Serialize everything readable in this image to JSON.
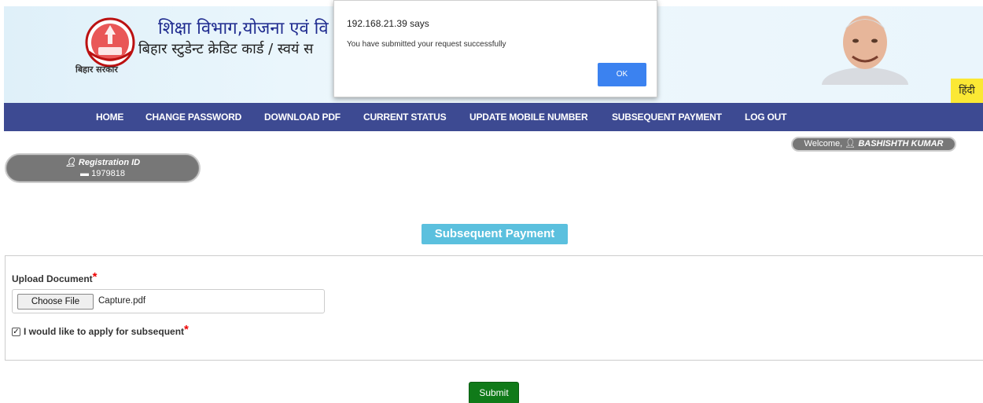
{
  "header": {
    "emblem_caption": "बिहार सरकार",
    "title_line1": "शिक्षा विभाग,योजना एवं वि",
    "title_line2": "बिहार स्टुडेन्ट क्रेडिट कार्ड / स्वयं स",
    "language_toggle": "हिंदी",
    "colors": {
      "nav_bg": "#3d4a92",
      "header_bg": "#dff0f9",
      "language_bg": "#fbe834"
    }
  },
  "dialog": {
    "title": "192.168.21.39 says",
    "message": "You have submitted your request successfully",
    "ok_label": "OK",
    "ok_color": "#3b82f0"
  },
  "nav": {
    "items": [
      {
        "label": "HOME"
      },
      {
        "label": "CHANGE PASSWORD"
      },
      {
        "label": "DOWNLOAD PDF"
      },
      {
        "label": "CURRENT STATUS"
      },
      {
        "label": "UPDATE MOBILE NUMBER"
      },
      {
        "label": "SUBSEQUENT PAYMENT"
      },
      {
        "label": "LOG OUT"
      }
    ]
  },
  "user": {
    "welcome_prefix": "Welcome,",
    "name": "BASHISHTH KUMAR",
    "registration_label": "Registration ID",
    "registration_id": "1979818",
    "icons": [
      "user-icon",
      "id-card-icon"
    ]
  },
  "form": {
    "page_title": "Subsequent Payment",
    "page_title_color": "#5bc0de",
    "upload_label": "Upload Document",
    "required_marker": "*",
    "file_button_label": "Choose File",
    "file_name": "Capture.pdf",
    "checkbox_label": "I would like to apply for subsequent",
    "checkbox_checked": true,
    "submit_label": "Submit",
    "submit_color": "#107a19"
  }
}
